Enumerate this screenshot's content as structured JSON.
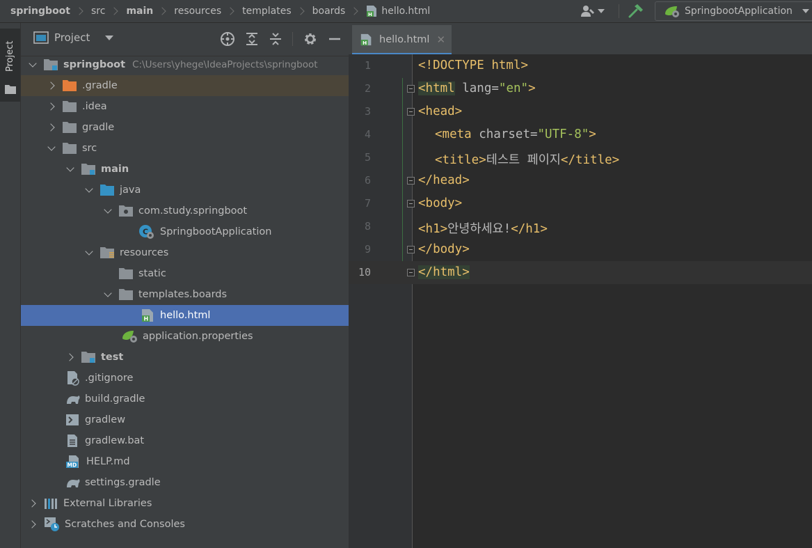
{
  "breadcrumbs": {
    "items": [
      {
        "label": "springboot",
        "bold": true
      },
      {
        "label": "src",
        "bold": false
      },
      {
        "label": "main",
        "bold": true
      },
      {
        "label": "resources",
        "bold": false
      },
      {
        "label": "templates",
        "bold": false
      },
      {
        "label": "boards",
        "bold": false
      },
      {
        "label": "hello.html",
        "bold": false
      }
    ]
  },
  "toolbar": {
    "run_config_label": "SpringbootApplication"
  },
  "stripe": {
    "project_label": "Project"
  },
  "project_panel": {
    "title": "Project",
    "tree": [
      {
        "label": "springboot",
        "path": "C:\\Users\\yhege\\IdeaProjects\\springboot",
        "bold": true,
        "expanded": true
      },
      {
        "label": ".gradle"
      },
      {
        "label": ".idea"
      },
      {
        "label": "gradle"
      },
      {
        "label": "src"
      },
      {
        "label": "main"
      },
      {
        "label": "java"
      },
      {
        "label": "com.study.springboot"
      },
      {
        "label": "SpringbootApplication"
      },
      {
        "label": "resources"
      },
      {
        "label": "static"
      },
      {
        "label": "templates.boards"
      },
      {
        "label": "hello.html"
      },
      {
        "label": "application.properties"
      },
      {
        "label": "test"
      },
      {
        "label": ".gitignore"
      },
      {
        "label": "build.gradle"
      },
      {
        "label": "gradlew"
      },
      {
        "label": "gradlew.bat"
      },
      {
        "label": "HELP.md"
      },
      {
        "label": "settings.gradle"
      },
      {
        "label": "External Libraries"
      },
      {
        "label": "Scratches and Consoles"
      }
    ]
  },
  "editor": {
    "tab_label": "hello.html",
    "lines": [
      {
        "n": "1"
      },
      {
        "n": "2"
      },
      {
        "n": "3"
      },
      {
        "n": "4"
      },
      {
        "n": "5"
      },
      {
        "n": "6"
      },
      {
        "n": "7"
      },
      {
        "n": "8"
      },
      {
        "n": "9"
      },
      {
        "n": "10"
      }
    ],
    "code": {
      "l1": "<!DOCTYPE html>",
      "l2_open": "<html",
      "l2_attr": " lang=",
      "l2_val": "\"en\"",
      "l2_close": ">",
      "l3": "<head>",
      "l4_open": "<meta",
      "l4_attr": " charset=",
      "l4_val": "\"UTF-8\"",
      "l4_close": ">",
      "l5_open": "<title>",
      "l5_text": "테스트 페이지",
      "l5_close": "</title>",
      "l6": "</head>",
      "l7": "<body>",
      "l8_open": "<h1>",
      "l8_text": "안녕하세요!",
      "l8_close": "</h1>",
      "l9": "</body>",
      "l10": "</html>"
    }
  },
  "colors": {
    "selection": "#4b6eaf",
    "tag": "#e8bf6a",
    "string": "#a5c25c",
    "html_icon": "#4c9a4c",
    "folder": "#8b9196",
    "source_folder": "#3592c4",
    "gradle_folder": "#e57d3b"
  }
}
